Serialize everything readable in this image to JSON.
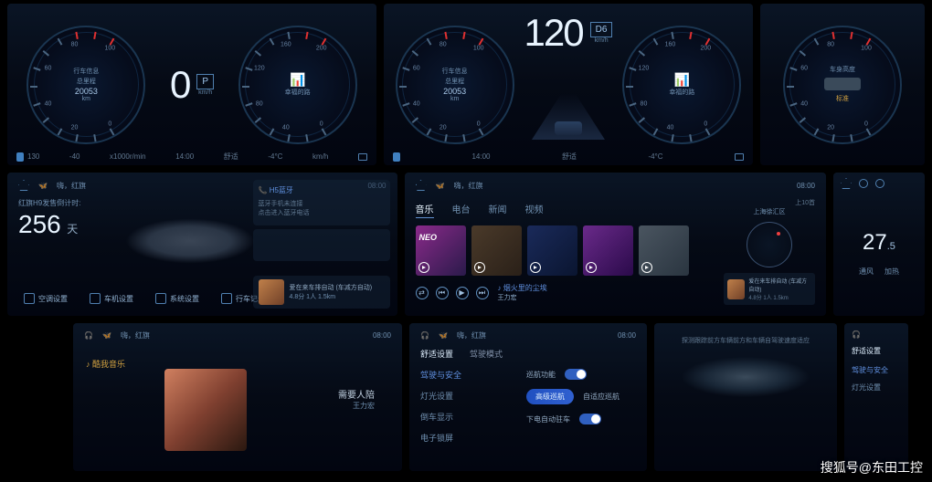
{
  "watermark": "搜狐号@东田工控",
  "cluster1": {
    "title": "行车信息",
    "odo_label": "总里程",
    "odo_value": "20053",
    "odo_unit": "km",
    "speed": "0",
    "speed_unit": "km/h",
    "gear": "P",
    "adas_label": "幸福的路",
    "time": "14:00",
    "mode": "舒适",
    "temp": "-4°C",
    "temp_a": "130",
    "temp_b": "-40",
    "rpm_unit": "x1000r/min",
    "right_unit": "km/h"
  },
  "cluster2": {
    "title": "行车信息",
    "odo_label": "总里程",
    "odo_value": "20053",
    "odo_unit": "km",
    "speed": "120",
    "speed_unit": "km/h",
    "gear": "D6",
    "adas_label": "幸福的路",
    "time": "14:00",
    "mode": "舒适",
    "temp": "-4°C"
  },
  "cluster3": {
    "title": "车身高度",
    "std": "标准"
  },
  "home": {
    "greeting": "嗨，红旗",
    "time": "08:00",
    "cd_label": "红旗H9发售倒计时:",
    "days": "256",
    "days_unit": "天",
    "btn1": "空调设置",
    "btn2": "车机设置",
    "btn3": "系统设置",
    "btn4": "行车记录",
    "card1_title": "H5蓝牙",
    "card1_text": "蓝牙手机未连接\n点击进入蓝牙电话",
    "card3_title": "爱在来车排自动 (车减方自动)",
    "card3_meta": "4.8分   1人  1.5km"
  },
  "media": {
    "greeting": "嗨，红旗",
    "time": "08:00",
    "tab1": "音乐",
    "tab2": "电台",
    "tab3": "新闻",
    "tab4": "视频",
    "more": "上10首",
    "neon": "NEO",
    "now_playing": "烟火里的尘埃",
    "artist": "王力宏",
    "nav_loc": "上海徐汇区",
    "card_title": "爱在来车排自动 (车减方自动)",
    "card_meta": "4.8分   1人  1.5km"
  },
  "climate": {
    "temp": "27",
    "temp_dec": ".5",
    "b1": "通风",
    "b2": "加热"
  },
  "music": {
    "greeting": "嗨，红旗",
    "time": "08:00",
    "app": "酷我音乐",
    "song": "需要人陪",
    "artist": "王力宏"
  },
  "settings": {
    "greeting": "嗨，红旗",
    "time": "08:00",
    "tab1": "舒适设置",
    "tab2": "驾驶模式",
    "menu1": "驾驶与安全",
    "menu2": "灯光设置",
    "menu3": "倒车显示",
    "menu4": "电子锁屏",
    "r1_label": "巡航功能",
    "r2_opt1": "高级巡航",
    "r2_opt2": "自适应巡航",
    "r3_label": "下电自动驻车",
    "desc": "探测跟踪前方车辆前方和车辆自驾驶速度适应"
  },
  "gauge_ticks": [
    "0",
    "20",
    "40",
    "60",
    "80",
    "100"
  ],
  "speed_ticks": [
    "0",
    "40",
    "80",
    "120",
    "160",
    "200"
  ]
}
